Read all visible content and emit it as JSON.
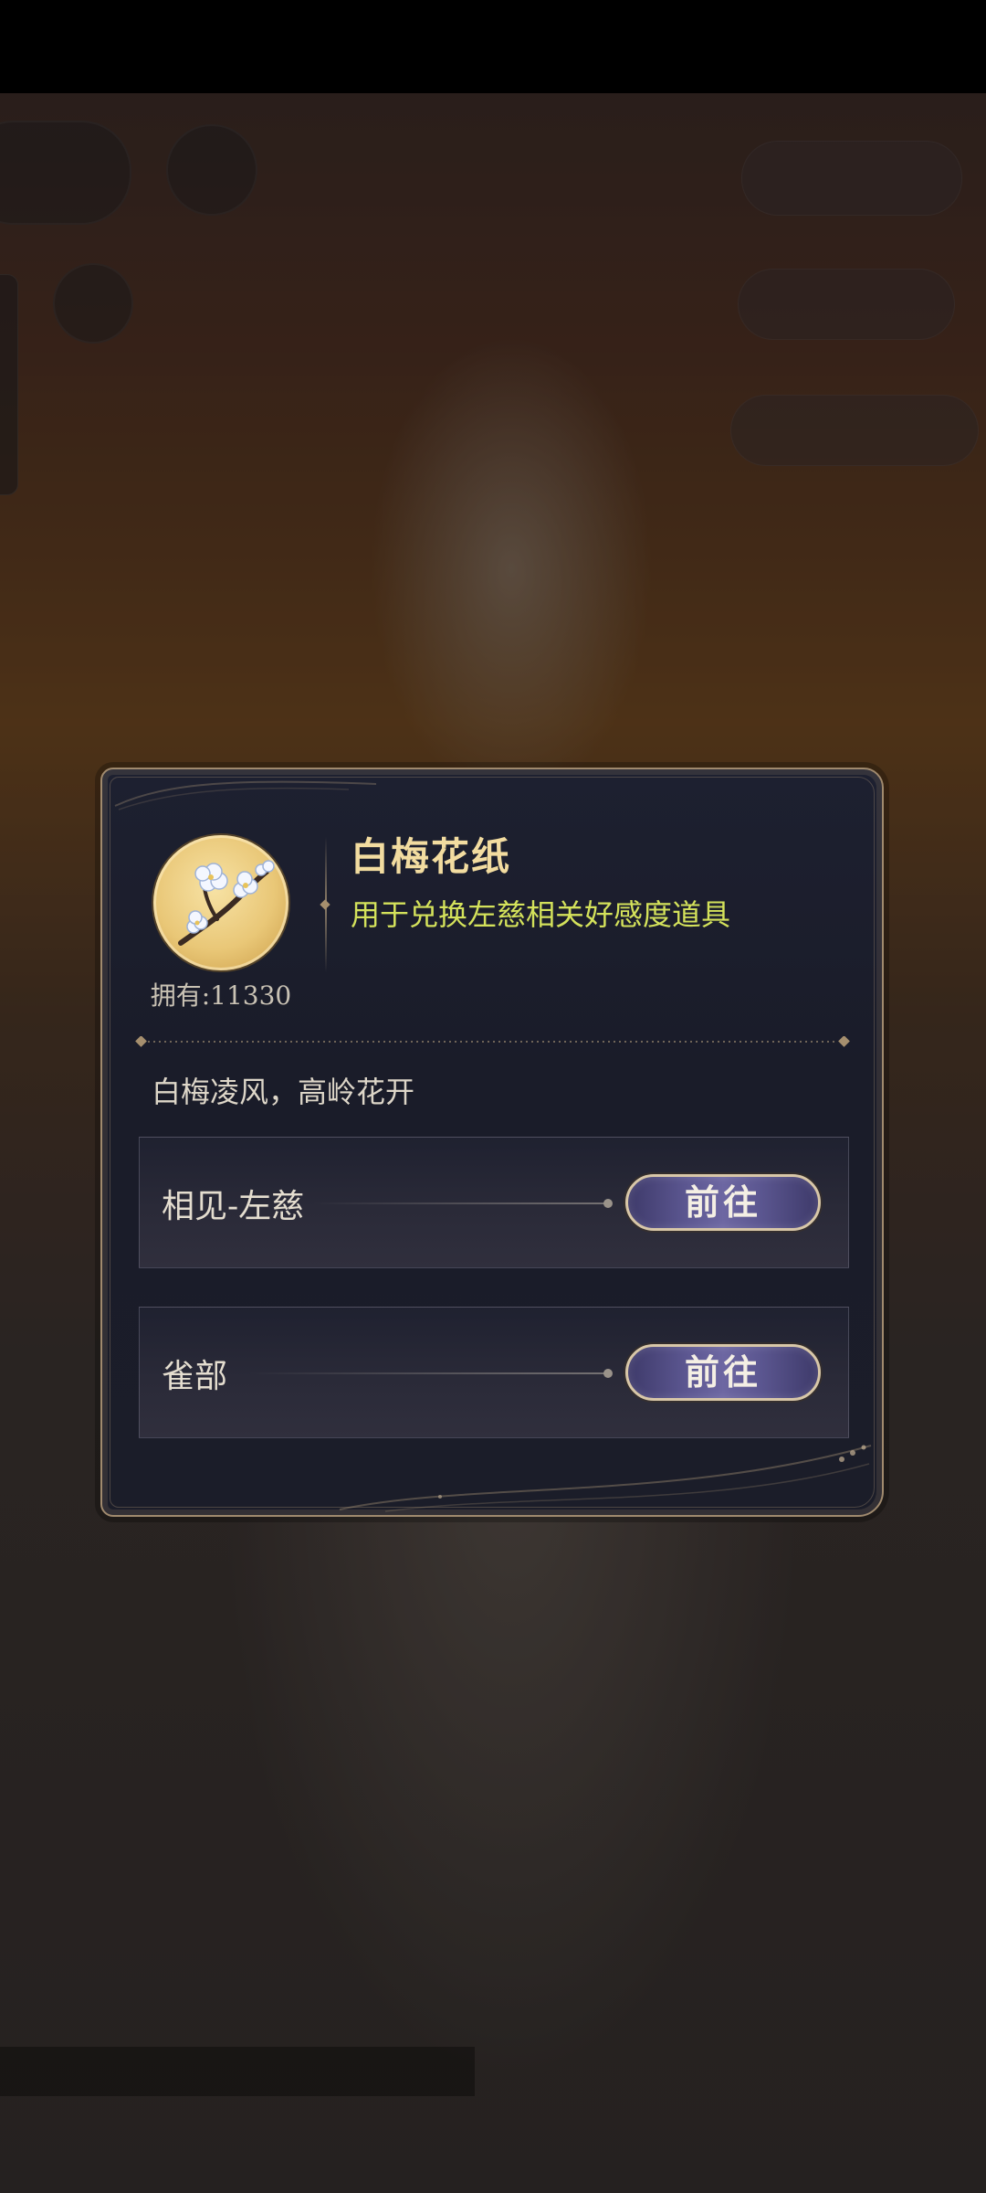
{
  "item": {
    "name": "白梅花纸",
    "description": "用于兑换左慈相关好感度道具",
    "owned_label": "拥有:11330",
    "icon": "plum-blossom-icon"
  },
  "flavor_text": "白梅凌风，高岭花开",
  "sources": [
    {
      "label": "相见-左慈",
      "button_label": "前往"
    },
    {
      "label": "雀部",
      "button_label": "前往"
    }
  ],
  "colors": {
    "title": "#f2dca0",
    "description": "#d4e25b",
    "dialog_bg": "#1b1d29",
    "frame": "#a08a6e",
    "button": "#5b5690"
  }
}
